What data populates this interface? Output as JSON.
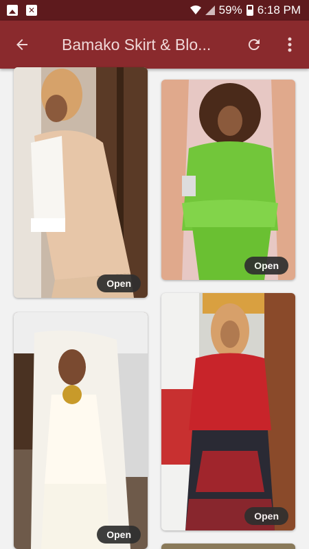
{
  "status_bar": {
    "battery": "59%",
    "time": "6:18 PM"
  },
  "app_bar": {
    "title": "Bamako Skirt & Blo..."
  },
  "cards": [
    {
      "open_label": "Open",
      "alt": "Beige lace blouse and skirt"
    },
    {
      "open_label": "Open",
      "alt": "Lime green peplum blouse and skirt"
    },
    {
      "open_label": "Open",
      "alt": "White lace bridal skirt and blouse"
    },
    {
      "open_label": "Open",
      "alt": "Red and black print peplum outfit"
    }
  ]
}
